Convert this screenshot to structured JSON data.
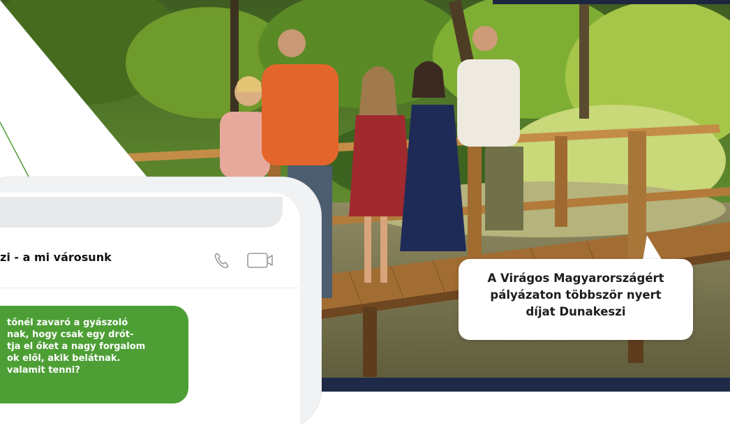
{
  "chat": {
    "title": "zi - a mi városunk",
    "message": "tőnél zavaró a gyászoló\nnak, hogy csak egy drót-\ntja el őket a nagy forgalom\nok elől, akik belátnak.\nvalamit tenni?"
  },
  "icons": {
    "call": "phone-icon",
    "video": "video-camera-icon"
  },
  "caption": {
    "line1": "A Virágos Magyarországért",
    "line2": "pályázaton többször nyert",
    "line3": "díjat Dunakeszi"
  },
  "colors": {
    "accent_green": "#4d9f35",
    "dark_navy": "#1e2a47",
    "wood": "#b8823f"
  }
}
